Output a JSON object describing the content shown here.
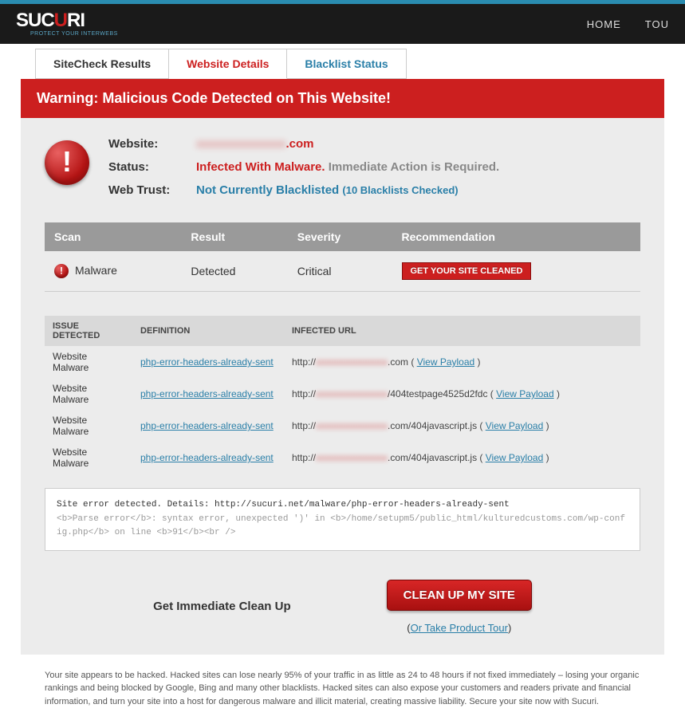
{
  "nav": {
    "home": "HOME",
    "tour_trunc": "TOU"
  },
  "tabs": {
    "sitecheck": "SiteCheck Results",
    "details": "Website Details",
    "blacklist": "Blacklist Status"
  },
  "banner": "Warning: Malicious Code Detected on This Website!",
  "summary": {
    "website_label": "Website:",
    "website_blur": "xxxxxxxxxxxxxxx",
    "website_suffix": ".com",
    "status_label": "Status:",
    "status_red": "Infected With Malware.",
    "status_gray": "Immediate Action is Required.",
    "trust_label": "Web Trust:",
    "trust_blue": "Not Currently Blacklisted",
    "trust_detail": "(10 Blacklists Checked)"
  },
  "scan_headers": {
    "scan": "Scan",
    "result": "Result",
    "severity": "Severity",
    "rec": "Recommendation"
  },
  "scan_row": {
    "scan": "Malware",
    "result": "Detected",
    "severity": "Critical",
    "button": "GET YOUR SITE CLEANED"
  },
  "issues_headers": {
    "issue": "ISSUE DETECTED",
    "def": "DEFINITION",
    "url": "INFECTED URL"
  },
  "issues": [
    {
      "issue": "Website Malware",
      "def": "php-error-headers-already-sent",
      "url_prefix": "http://",
      "url_blur": "xxxxxxxxxxxxxxx",
      "url_suffix": ".com",
      "view": "View Payload"
    },
    {
      "issue": "Website Malware",
      "def": "php-error-headers-already-sent",
      "url_prefix": "http://",
      "url_blur": "xxxxxxxxxxxxxxx",
      "url_suffix": "/404testpage4525d2fdc",
      "view": "View Payload"
    },
    {
      "issue": "Website Malware",
      "def": "php-error-headers-already-sent",
      "url_prefix": "http://",
      "url_blur": "xxxxxxxxxxxxxxx",
      "url_suffix": ".com/404javascript.js",
      "view": "View Payload"
    },
    {
      "issue": "Website Malware",
      "def": "php-error-headers-already-sent",
      "url_prefix": "http://",
      "url_blur": "xxxxxxxxxxxxxxx",
      "url_suffix": ".com/404javascript.js",
      "view": "View Payload"
    }
  ],
  "error_box": {
    "line1": "Site error detected. Details: http://sucuri.net/malware/php-error-headers-already-sent",
    "line2": "<b>Parse error</b>:  syntax error, unexpected ')' in <b>/home/setupm5/public_html/kulturedcustoms.com/wp-config.php</b> on line <b>91</b><br />"
  },
  "cta": {
    "label": "Get Immediate Clean Up",
    "button": "CLEAN UP MY SITE",
    "or_open": "(",
    "tour": "Or Take Product Tour",
    "or_close": ")"
  },
  "disclaimer": "Your site appears to be hacked. Hacked sites can lose nearly 95% of your traffic in as little as 24 to 48 hours if not fixed immediately – losing your organic rankings and being blocked by Google, Bing and many other blacklists. Hacked sites can also expose your customers and readers private and financial information, and turn your site into a host for dangerous malware and illicit material, creating massive liability. Secure your site now with Sucuri."
}
